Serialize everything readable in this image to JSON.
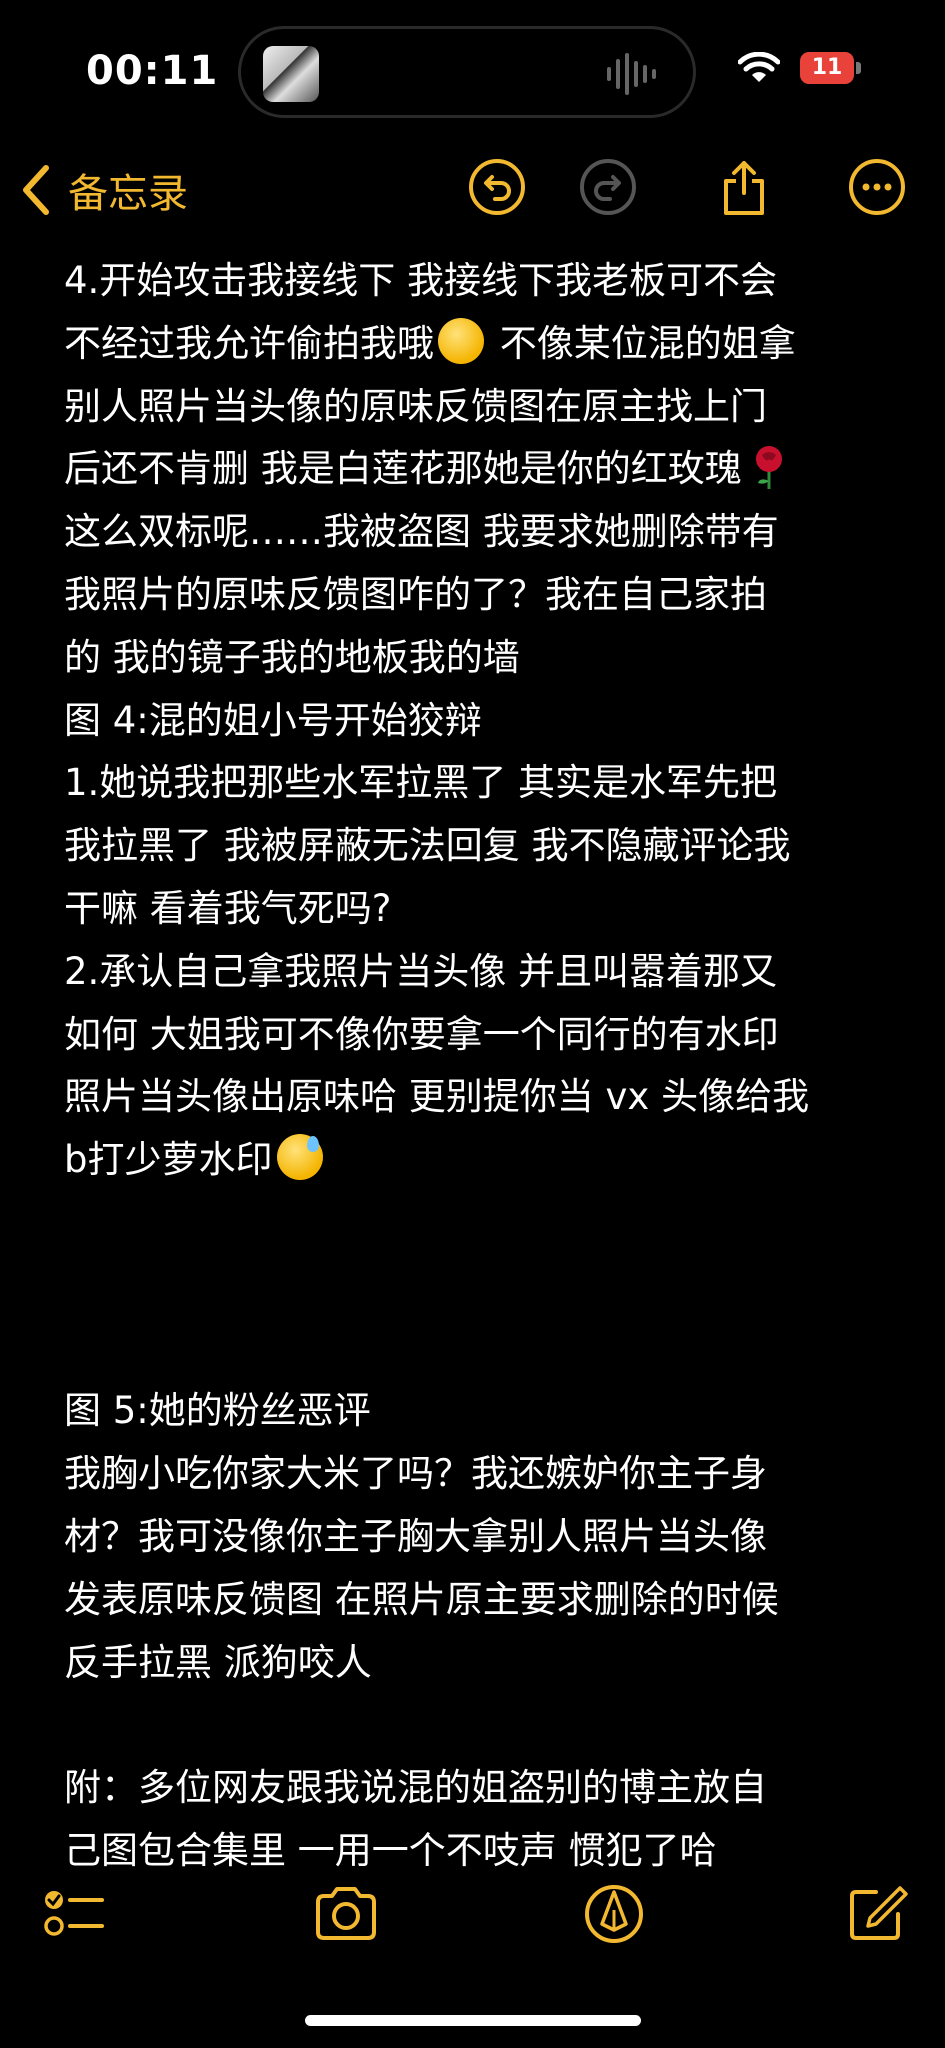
{
  "status_bar": {
    "time": "00:11",
    "battery_level": "11",
    "island_icons": [
      "album-thumbnail",
      "audio-waveform-icon"
    ]
  },
  "nav": {
    "back_label": "备忘录",
    "buttons": [
      "undo-icon",
      "redo-icon",
      "share-icon",
      "more-icon"
    ]
  },
  "note": {
    "lines": [
      "4.开始攻击我接线下 我接线下我老板可不会",
      "不经过我允许偷拍我哦",
      " 不像某位混的姐拿",
      "别人照片当头像的原味反馈图在原主找上门",
      "后还不肯删 我是白莲花那她是你的红玫瑰",
      "这么双标呢……我被盗图 我要求她删除带有",
      "我照片的原味反馈图咋的了？我在自己家拍",
      "的 我的镜子我的地板我的墙",
      "图 4:混的姐小号开始狡辩",
      "1.她说我把那些水军拉黑了 其实是水军先把",
      "我拉黑了 我被屏蔽无法回复 我不隐藏评论我",
      "干嘛 看着我气死吗?",
      "2.承认自己拿我照片当头像 并且叫嚣着那又",
      "如何 大姐我可不像你要拿一个同行的有水印",
      "照片当头像出原味哈 更别提你当 vx 头像给我",
      "b打少萝水印",
      "图 5:她的粉丝恶评",
      "我胸小吃你家大米了吗？我还嫉妒你主子身",
      "材？我可没像你主子胸大拿别人照片当头像",
      "发表原味反馈图 在照片原主要求删除的时候",
      "反手拉黑 派狗咬人",
      "附：多位网友跟我说混的姐盗别的博主放自",
      "己图包合集里 一用一个不吱声 惯犯了哈"
    ],
    "emojis": [
      "yum-emoji",
      "rose-emoji",
      "sweat-emoji"
    ]
  },
  "toolbar": {
    "buttons": [
      "checklist-icon",
      "camera-icon",
      "markup-icon",
      "compose-icon"
    ]
  },
  "colors": {
    "accent": "#f2b830",
    "background": "#000000",
    "text": "#ffffff",
    "battery": "#e8423b"
  }
}
